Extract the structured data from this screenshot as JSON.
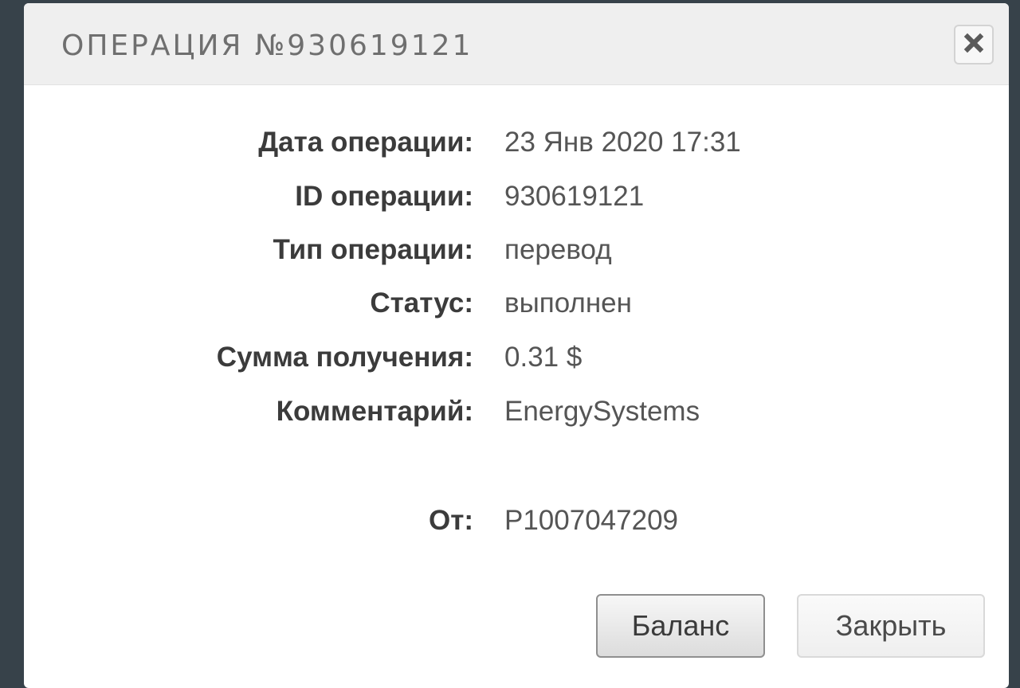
{
  "modal": {
    "title": "ОПЕРАЦИЯ №930619121",
    "close_icon": "close-icon"
  },
  "details": [
    {
      "label": "Дата операции:",
      "value": "23 Янв 2020 17:31"
    },
    {
      "label": "ID операции:",
      "value": "930619121"
    },
    {
      "label": "Тип операции:",
      "value": "перевод"
    },
    {
      "label": "Статус:",
      "value": "выполнен"
    },
    {
      "label": "Сумма получения:",
      "value": "0.31 $"
    },
    {
      "label": "Комментарий:",
      "value": "EnergySystems"
    },
    {
      "label": "От:",
      "value": "P1007047209"
    }
  ],
  "buttons": {
    "balance_label": "Баланс",
    "close_label": "Закрыть"
  }
}
